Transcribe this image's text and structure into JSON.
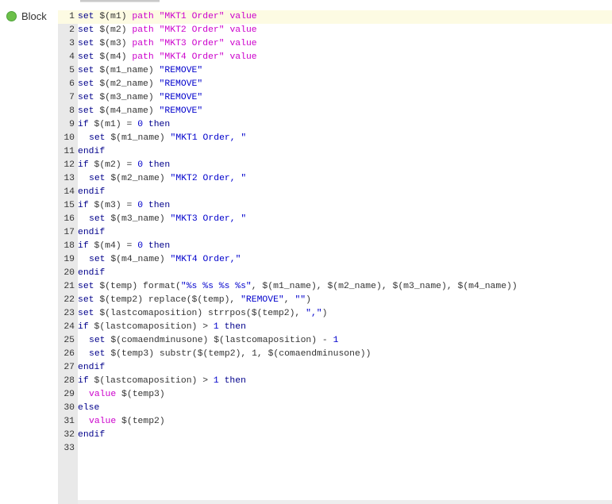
{
  "block": {
    "label": "Block",
    "status_color": "#6cc04a"
  },
  "editor": {
    "active_line": 1,
    "lines": [
      {
        "n": "1",
        "indent": 0,
        "tokens": [
          [
            "kw",
            "set"
          ],
          [
            "txt",
            " $(m1) "
          ],
          [
            "prop",
            "path"
          ],
          [
            "txt",
            " "
          ],
          [
            "prop",
            "\"MKT1 Order\""
          ],
          [
            "txt",
            " "
          ],
          [
            "prop",
            "value"
          ]
        ]
      },
      {
        "n": "2",
        "indent": 0,
        "tokens": [
          [
            "kw",
            "set"
          ],
          [
            "txt",
            " $(m2) "
          ],
          [
            "prop",
            "path"
          ],
          [
            "txt",
            " "
          ],
          [
            "prop",
            "\"MKT2 Order\""
          ],
          [
            "txt",
            " "
          ],
          [
            "prop",
            "value"
          ]
        ]
      },
      {
        "n": "3",
        "indent": 0,
        "tokens": [
          [
            "kw",
            "set"
          ],
          [
            "txt",
            " $(m3) "
          ],
          [
            "prop",
            "path"
          ],
          [
            "txt",
            " "
          ],
          [
            "prop",
            "\"MKT3 Order\""
          ],
          [
            "txt",
            " "
          ],
          [
            "prop",
            "value"
          ]
        ]
      },
      {
        "n": "4",
        "indent": 0,
        "tokens": [
          [
            "kw",
            "set"
          ],
          [
            "txt",
            " $(m4) "
          ],
          [
            "prop",
            "path"
          ],
          [
            "txt",
            " "
          ],
          [
            "prop",
            "\"MKT4 Order\""
          ],
          [
            "txt",
            " "
          ],
          [
            "prop",
            "value"
          ]
        ]
      },
      {
        "n": "5",
        "indent": 0,
        "tokens": [
          [
            "kw",
            "set"
          ],
          [
            "txt",
            " $(m1_name) "
          ],
          [
            "str",
            "\"REMOVE\""
          ]
        ]
      },
      {
        "n": "6",
        "indent": 0,
        "tokens": [
          [
            "kw",
            "set"
          ],
          [
            "txt",
            " $(m2_name) "
          ],
          [
            "str",
            "\"REMOVE\""
          ]
        ]
      },
      {
        "n": "7",
        "indent": 0,
        "tokens": [
          [
            "kw",
            "set"
          ],
          [
            "txt",
            " $(m3_name) "
          ],
          [
            "str",
            "\"REMOVE\""
          ]
        ]
      },
      {
        "n": "8",
        "indent": 0,
        "tokens": [
          [
            "kw",
            "set"
          ],
          [
            "txt",
            " $(m4_name) "
          ],
          [
            "str",
            "\"REMOVE\""
          ]
        ]
      },
      {
        "n": "9",
        "indent": 0,
        "tokens": [
          [
            "kw",
            "if"
          ],
          [
            "txt",
            " $(m1) = "
          ],
          [
            "num",
            "0"
          ],
          [
            "txt",
            " "
          ],
          [
            "kw",
            "then"
          ]
        ]
      },
      {
        "n": "10",
        "indent": 1,
        "tokens": [
          [
            "kw",
            "set"
          ],
          [
            "txt",
            " $(m1_name) "
          ],
          [
            "str",
            "\"MKT1 Order, \""
          ]
        ]
      },
      {
        "n": "11",
        "indent": 0,
        "tokens": [
          [
            "kw",
            "endif"
          ]
        ]
      },
      {
        "n": "12",
        "indent": 0,
        "tokens": [
          [
            "kw",
            "if"
          ],
          [
            "txt",
            " $(m2) = "
          ],
          [
            "num",
            "0"
          ],
          [
            "txt",
            " "
          ],
          [
            "kw",
            "then"
          ]
        ]
      },
      {
        "n": "13",
        "indent": 1,
        "tokens": [
          [
            "kw",
            "set"
          ],
          [
            "txt",
            " $(m2_name) "
          ],
          [
            "str",
            "\"MKT2 Order, \""
          ]
        ]
      },
      {
        "n": "14",
        "indent": 0,
        "tokens": [
          [
            "kw",
            "endif"
          ]
        ]
      },
      {
        "n": "15",
        "indent": 0,
        "tokens": [
          [
            "kw",
            "if"
          ],
          [
            "txt",
            " $(m3) = "
          ],
          [
            "num",
            "0"
          ],
          [
            "txt",
            " "
          ],
          [
            "kw",
            "then"
          ]
        ]
      },
      {
        "n": "16",
        "indent": 1,
        "tokens": [
          [
            "kw",
            "set"
          ],
          [
            "txt",
            " $(m3_name) "
          ],
          [
            "str",
            "\"MKT3 Order, \""
          ]
        ]
      },
      {
        "n": "17",
        "indent": 0,
        "tokens": [
          [
            "kw",
            "endif"
          ]
        ]
      },
      {
        "n": "18",
        "indent": 0,
        "tokens": [
          [
            "kw",
            "if"
          ],
          [
            "txt",
            " $(m4) = "
          ],
          [
            "num",
            "0"
          ],
          [
            "txt",
            " "
          ],
          [
            "kw",
            "then"
          ]
        ]
      },
      {
        "n": "19",
        "indent": 1,
        "tokens": [
          [
            "kw",
            "set"
          ],
          [
            "txt",
            " $(m4_name) "
          ],
          [
            "str",
            "\"MKT4 Order,\""
          ]
        ]
      },
      {
        "n": "20",
        "indent": 0,
        "tokens": [
          [
            "kw",
            "endif"
          ]
        ]
      },
      {
        "n": "21",
        "indent": 0,
        "tokens": [
          [
            "kw",
            "set"
          ],
          [
            "txt",
            " $(temp) format("
          ],
          [
            "str",
            "\"%s %s %s %s\""
          ],
          [
            "txt",
            ", $(m1_name), $(m2_name), $(m3_name), $(m4_name))"
          ]
        ]
      },
      {
        "n": "22",
        "indent": 0,
        "tokens": [
          [
            "kw",
            "set"
          ],
          [
            "txt",
            " $(temp2) replace($(temp), "
          ],
          [
            "str",
            "\"REMOVE\""
          ],
          [
            "txt",
            ", "
          ],
          [
            "str",
            "\"\""
          ],
          [
            "txt",
            ")"
          ]
        ]
      },
      {
        "n": "23",
        "indent": 0,
        "tokens": [
          [
            "kw",
            "set"
          ],
          [
            "txt",
            " $(lastcomaposition) strrpos($(temp2), "
          ],
          [
            "str",
            "\",\""
          ],
          [
            "txt",
            ")"
          ]
        ]
      },
      {
        "n": "24",
        "indent": 0,
        "tokens": [
          [
            "kw",
            "if"
          ],
          [
            "txt",
            " $(lastcomaposition) > "
          ],
          [
            "num",
            "1"
          ],
          [
            "txt",
            " "
          ],
          [
            "kw",
            "then"
          ]
        ]
      },
      {
        "n": "25",
        "indent": 1,
        "tokens": [
          [
            "kw",
            "set"
          ],
          [
            "txt",
            " $(comaendminusone) $(lastcomaposition) - "
          ],
          [
            "num",
            "1"
          ]
        ]
      },
      {
        "n": "26",
        "indent": 1,
        "tokens": [
          [
            "kw",
            "set"
          ],
          [
            "txt",
            " $(temp3) substr($(temp2), 1, $(comaendminusone))"
          ]
        ]
      },
      {
        "n": "27",
        "indent": 0,
        "tokens": [
          [
            "kw",
            "endif"
          ]
        ]
      },
      {
        "n": "28",
        "indent": 0,
        "tokens": [
          [
            "kw",
            "if"
          ],
          [
            "txt",
            " $(lastcomaposition) > "
          ],
          [
            "num",
            "1"
          ],
          [
            "txt",
            " "
          ],
          [
            "kw",
            "then"
          ]
        ]
      },
      {
        "n": "29",
        "indent": 1,
        "tokens": [
          [
            "prop",
            "value"
          ],
          [
            "txt",
            " $(temp3)"
          ]
        ]
      },
      {
        "n": "30",
        "indent": 0,
        "tokens": [
          [
            "kw",
            "else"
          ]
        ]
      },
      {
        "n": "31",
        "indent": 1,
        "tokens": [
          [
            "prop",
            "value"
          ],
          [
            "txt",
            " $(temp2)"
          ]
        ]
      },
      {
        "n": "32",
        "indent": 0,
        "tokens": [
          [
            "kw",
            "endif"
          ]
        ]
      },
      {
        "n": "33",
        "indent": 0,
        "tokens": []
      }
    ]
  }
}
